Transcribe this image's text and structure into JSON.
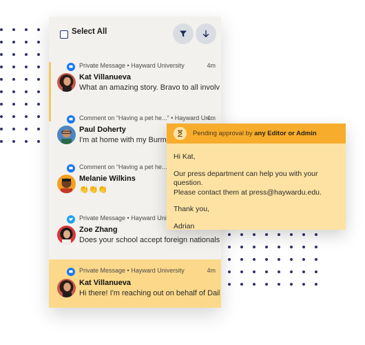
{
  "toolbar": {
    "select_all": "Select All",
    "filter_icon": "filter-icon",
    "sort_icon": "arrow-down-icon"
  },
  "messages": [
    {
      "source": "Private Message",
      "org": "Hayward University",
      "time": "4m",
      "name": "Kat Villanueva",
      "text": "What an amazing story. Bravo to all involved!",
      "icon": "message-icon",
      "highlighted": false
    },
    {
      "source": "Comment on “Having a pet he...”",
      "org": "Hayward Un...",
      "time": "4m",
      "name": "Paul Doherty",
      "text": "I'm at home with my Burmese",
      "icon": "message-icon",
      "highlighted": false
    },
    {
      "source": "Comment on “Having a pet he...”",
      "org": "",
      "time": "",
      "name": "Melanie Wilkins",
      "text": "👏👏👏",
      "icon": "message-icon",
      "highlighted": false
    },
    {
      "source": "Private Message",
      "org": "Hayward Univer",
      "time": "",
      "name": "Zoe Zhang",
      "text": "Does your school accept foreign nationals?",
      "icon": "twitter-icon",
      "highlighted": false
    },
    {
      "source": "Private Message",
      "org": "Hayward University",
      "time": "4m",
      "name": "Kat Villanueva",
      "text": "Hi there! I'm reaching out on behalf of Daily...",
      "icon": "message-icon",
      "highlighted": true
    }
  ],
  "popup": {
    "header_prefix": "Pending approval by",
    "header_strong": "any Editor or Admin",
    "greeting": "Hi Kat,",
    "line1": "Our press department can help you with your question.",
    "line2": "Please contact them at press@haywardu.edu.",
    "closing": "Thank you,",
    "signature": "Adrian"
  },
  "colors": {
    "panel_bg": "#f3f1ee",
    "highlight": "#fcd98a",
    "popup_header": "#f8ac2b",
    "popup_body": "#fde2a3",
    "dots": "#2f3068",
    "message_blue": "#1877f2",
    "twitter_blue": "#1da1f2"
  }
}
